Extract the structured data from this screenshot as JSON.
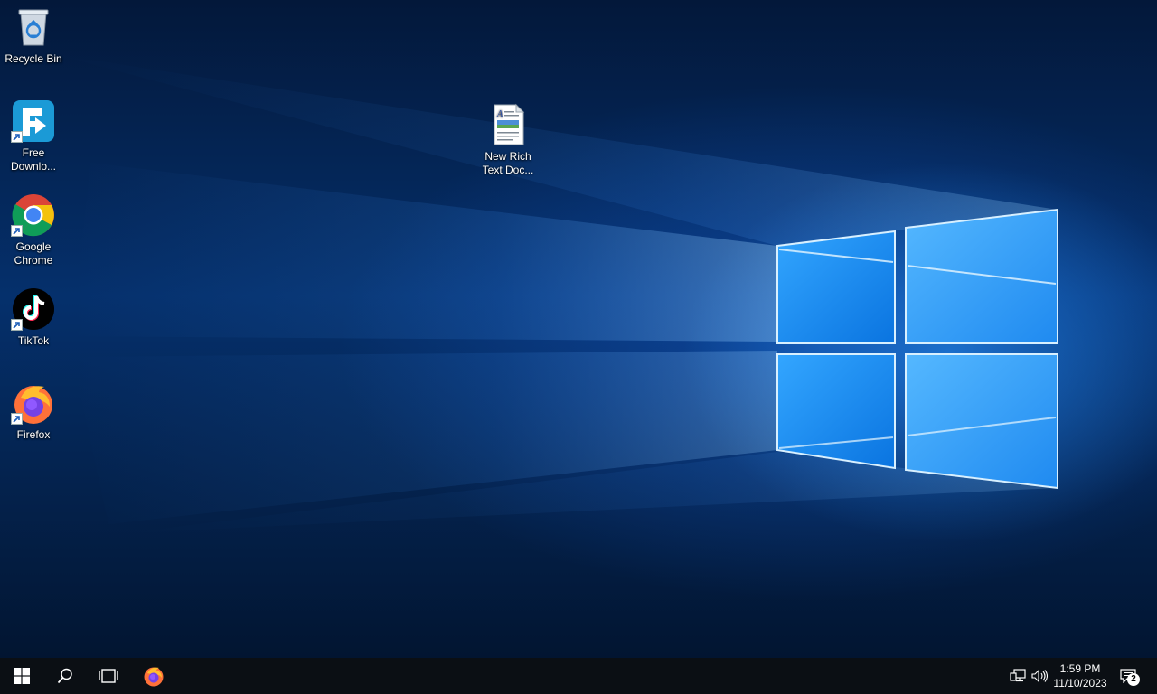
{
  "desktop": {
    "icons": [
      {
        "label": "Recycle Bin",
        "icon": "recycle-bin-icon"
      },
      {
        "label": "Free\nDownlo...",
        "icon": "free-download-manager-icon"
      },
      {
        "label": "Google\nChrome",
        "icon": "chrome-icon"
      },
      {
        "label": "TikTok",
        "icon": "tiktok-icon"
      },
      {
        "label": "Firefox",
        "icon": "firefox-icon"
      },
      {
        "label": "New Rich\nText Doc...",
        "icon": "rich-text-document-icon"
      }
    ]
  },
  "taskbar": {
    "start": "windows-start-icon",
    "search": "search-icon",
    "task_view": "task-view-icon",
    "pinned": [
      "firefox-icon"
    ]
  },
  "tray": {
    "network": "network-icon",
    "volume": "volume-icon",
    "time": "1:59 PM",
    "date": "11/10/2023",
    "notifications": "action-center-icon",
    "notification_count": "2"
  },
  "colors": {
    "taskbar": "#0b0f14",
    "accent": "#3aa0ff"
  }
}
